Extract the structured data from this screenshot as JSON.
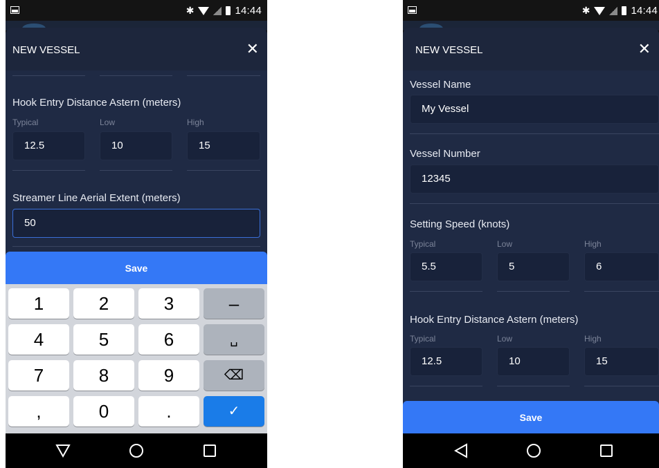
{
  "status": {
    "time": "14:44"
  },
  "left": {
    "title": "NEW VESSEL",
    "hook_label": "Hook Entry Distance Astern (meters)",
    "sub": {
      "typical": "Typical",
      "low": "Low",
      "high": "High"
    },
    "hook_values": {
      "typical": "12.5",
      "low": "10",
      "high": "15"
    },
    "streamer_label": "Streamer Line Aerial Extent (meters)",
    "streamer_value": "50",
    "save": "Save",
    "keys": {
      "k1": "1",
      "k2": "2",
      "k3": "3",
      "minus": "–",
      "k4": "4",
      "k5": "5",
      "k6": "6",
      "space": "␣",
      "k7": "7",
      "k8": "8",
      "k9": "9",
      "backspace": "⌫",
      "comma": ",",
      "k0": "0",
      "period": ".",
      "done": "✓"
    }
  },
  "right": {
    "title": "NEW VESSEL",
    "name_label": "Vessel Name",
    "name_value": "My Vessel",
    "number_label": "Vessel Number",
    "number_value": "12345",
    "speed_label": "Setting Speed (knots)",
    "sub": {
      "typical": "Typical",
      "low": "Low",
      "high": "High"
    },
    "speed_values": {
      "typical": "5.5",
      "low": "5",
      "high": "6"
    },
    "hook_label": "Hook Entry Distance Astern (meters)",
    "hook_values": {
      "typical": "12.5",
      "low": "10",
      "high": "15"
    },
    "save": "Save"
  },
  "icons": {
    "close": "✕",
    "bluetooth": "✱",
    "colors": {
      "accent": "#3478f6",
      "sheet": "#1f2a44",
      "field": "#18223a"
    }
  }
}
